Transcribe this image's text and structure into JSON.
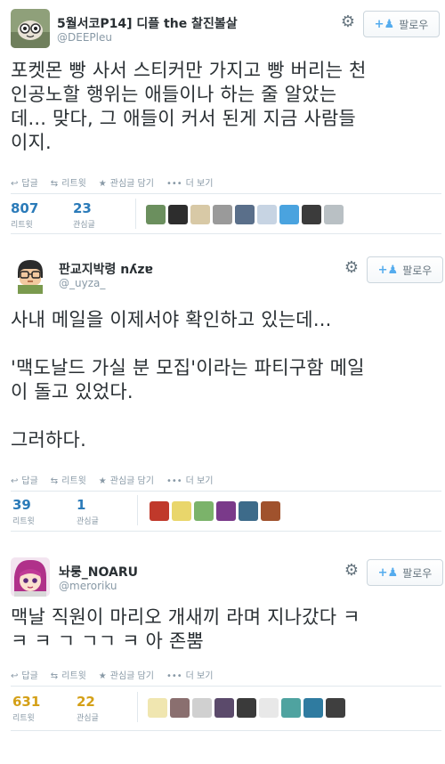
{
  "tweets": [
    {
      "name": "5월서코P14] 디플 the 찰진볼살",
      "handle": "@DEEPleu",
      "follow_label": "팔로우",
      "text": "포켓몬 빵 사서 스티커만 가지고 빵 버리는 천\n인공노할 행위는 애들이나 하는 줄 알았는\n데... 맞다, 그 애들이 커서 된게 지금 사람들\n이지.",
      "actions": [
        "답글",
        "리트윗",
        "관심글 담기",
        "더 보기"
      ],
      "retweets": "807",
      "retweets_label": "리트윗",
      "likes": "23",
      "likes_label": "관심글",
      "faces": [
        "#6b8f5e",
        "#2d2d2d",
        "#d8c9a6",
        "#9a9a9a",
        "#5a6f8a",
        "#c7d4e3",
        "#4aa3df",
        "#3b3b3b",
        "#b9c0c4"
      ]
    },
    {
      "name": "판교지박령 nʎzɐ",
      "handle": "@_uyza_",
      "follow_label": "팔로우",
      "text": "사내 메일을 이제서야 확인하고 있는데...\n\n'맥도날드 가실 분 모집'이라는 파티구함 메일\n이 돌고 있었다.\n\n그러하다.",
      "actions": [
        "답글",
        "리트윗",
        "관심글 담기",
        "더 보기"
      ],
      "retweets": "39",
      "retweets_label": "리트윗",
      "likes": "1",
      "likes_label": "관심글",
      "faces": [
        "#c0392b",
        "#e9d66b",
        "#7bb36a",
        "#7a3a8a",
        "#3d6b8a",
        "#a0522d"
      ]
    },
    {
      "name": "놔룽_NOARU",
      "handle": "@meroriku",
      "follow_label": "팔로우",
      "text": "맥날 직원이 마리오 개새끼 라며 지나갔다 ㅋ\nㅋ ㅋ ㄱ ㄱㄱ ㅋ 아 존뿜",
      "actions": [
        "답글",
        "리트윗",
        "관심글 담기",
        "더 보기"
      ],
      "retweets": "631",
      "retweets_label": "리트윗",
      "likes": "22",
      "likes_label": "관심글",
      "faces": [
        "#f0e6b0",
        "#8a6f6f",
        "#d0d0d0",
        "#5b4a6b",
        "#3a3a3a",
        "#e8e8e8",
        "#4fa3a0",
        "#2f7ba0",
        "#3f3f3f"
      ]
    }
  ],
  "icons": {
    "gear": "gear-icon",
    "follow": "add-person-icon",
    "reply": "reply-icon",
    "retweet": "retweet-icon",
    "favorite": "star-icon",
    "more": "more-icon"
  },
  "colors": {
    "link_blue": "#2b7bb9",
    "gray_text": "#8899a6",
    "follow_icon": "#55acee"
  }
}
